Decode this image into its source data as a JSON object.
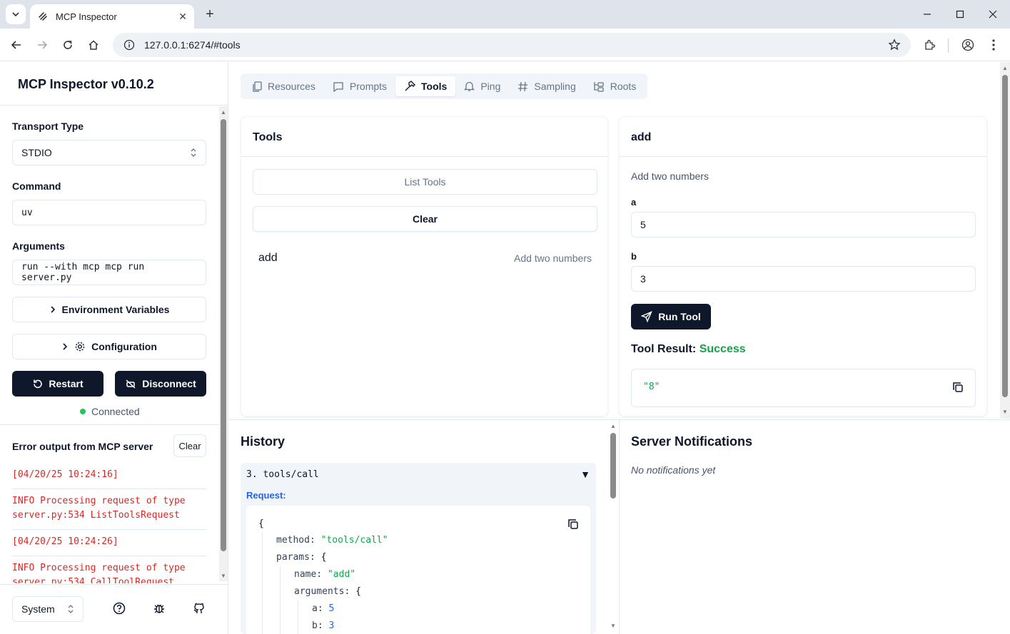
{
  "browser": {
    "tab_title": "MCP Inspector",
    "url": "127.0.0.1:6274/#tools"
  },
  "sidebar": {
    "title": "MCP Inspector v0.10.2",
    "transport_label": "Transport Type",
    "transport_value": "STDIO",
    "command_label": "Command",
    "command_value": "uv",
    "arguments_label": "Arguments",
    "arguments_value": "run --with mcp mcp run server.py",
    "env_button": "Environment Variables",
    "config_button": "Configuration",
    "restart_button": "Restart",
    "disconnect_button": "Disconnect",
    "status": "Connected",
    "status_color": "#22c55e",
    "error_title": "Error output from MCP server",
    "error_clear": "Clear",
    "error_lines": [
      "[04/20/25 10:24:16]",
      "INFO Processing request of type",
      "server.py:534 ListToolsRequest",
      "[04/20/25 10:24:26]",
      "INFO Processing request of type",
      "server.py:534 CallToolRequest"
    ],
    "theme_select": "System"
  },
  "main": {
    "tabs": [
      {
        "label": "Resources",
        "icon": "files-icon"
      },
      {
        "label": "Prompts",
        "icon": "message-icon"
      },
      {
        "label": "Tools",
        "icon": "hammer-icon",
        "active": true
      },
      {
        "label": "Ping",
        "icon": "bell-icon"
      },
      {
        "label": "Sampling",
        "icon": "hash-icon"
      },
      {
        "label": "Roots",
        "icon": "folder-tree-icon"
      }
    ],
    "tools_card": {
      "title": "Tools",
      "list_button": "List Tools",
      "clear_button": "Clear",
      "tool_name": "add",
      "tool_desc": "Add two numbers"
    },
    "tool_detail": {
      "title": "add",
      "description": "Add two numbers",
      "param_a_label": "a",
      "param_a_value": "5",
      "param_b_label": "b",
      "param_b_value": "3",
      "run_button": "Run Tool",
      "result_label": "Tool Result:",
      "result_status": "Success",
      "result_value": "\"8\""
    },
    "history": {
      "title": "History",
      "entry_title": "3. tools/call",
      "request_label": "Request:",
      "json": {
        "open": "{",
        "method_key": "method:",
        "method_val": "\"tools/call\"",
        "params_key": "params:",
        "params_open": "{",
        "name_key": "name:",
        "name_val": "\"add\"",
        "arguments_key": "arguments:",
        "arguments_open": "{",
        "a_key": "a:",
        "a_val": "5",
        "b_key": "b:",
        "b_val": "3"
      }
    },
    "notifications": {
      "title": "Server Notifications",
      "empty": "No notifications yet"
    }
  },
  "colors": {
    "primary_dark": "#0f172a",
    "success": "#16a34a",
    "error": "#dc2626",
    "request_label": "#2563eb"
  }
}
